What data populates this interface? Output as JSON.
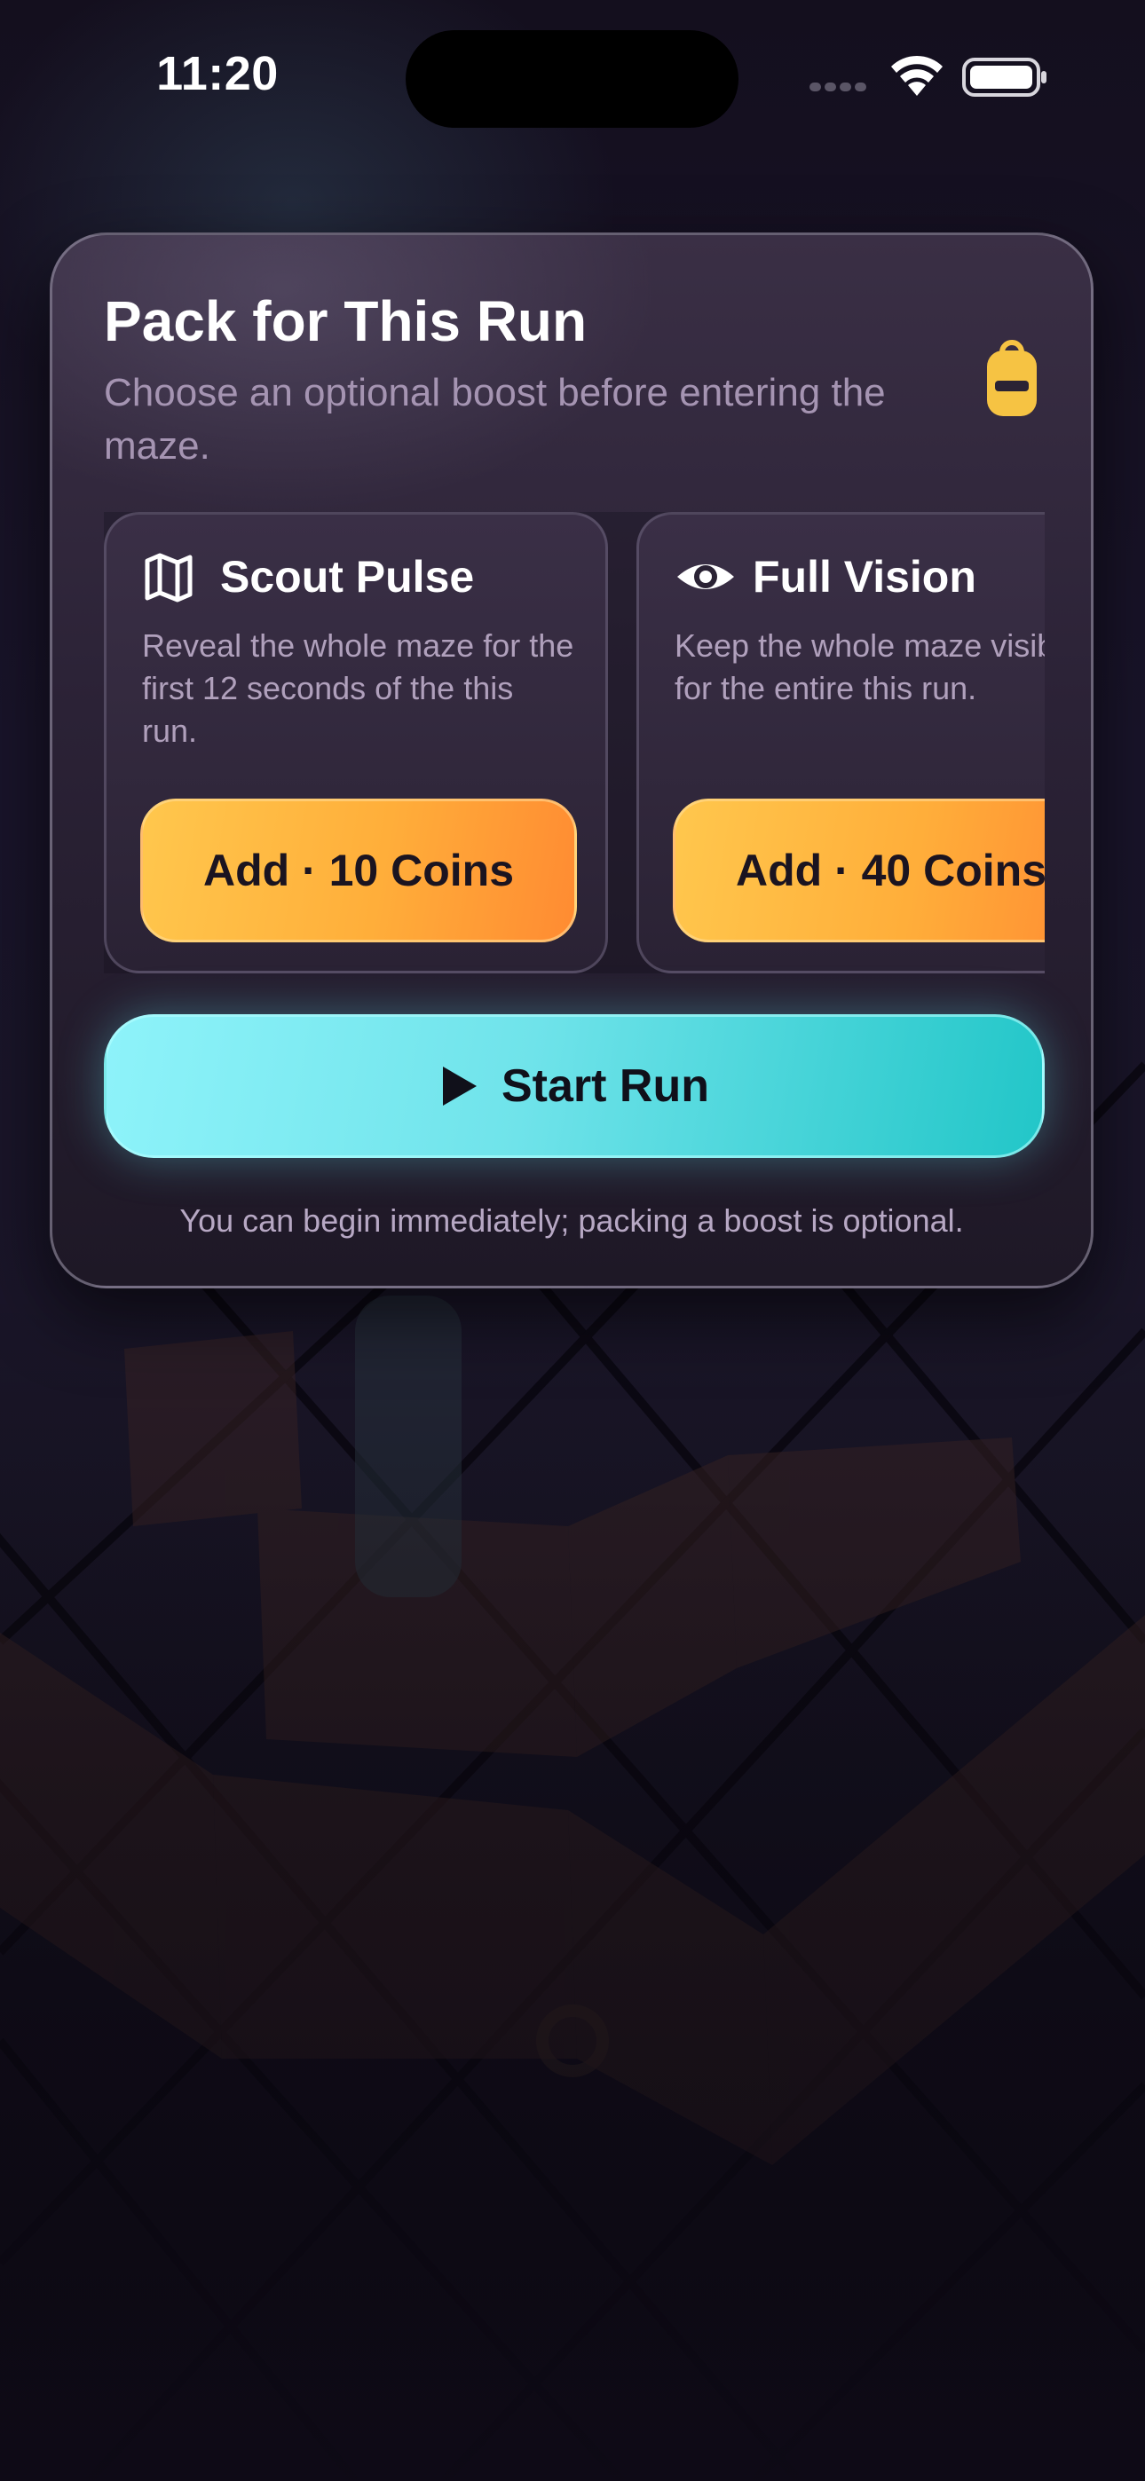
{
  "status_bar": {
    "time": "11:20"
  },
  "panel": {
    "title": "Pack for This Run",
    "subtitle": "Choose an optional boost before entering the maze.",
    "icon": "backpack-icon",
    "boosts": [
      {
        "icon": "map-icon",
        "title": "Scout Pulse",
        "description": "Reveal the whole maze for the first 12 seconds of the this run.",
        "button_label": "Add · 10 Coins"
      },
      {
        "icon": "eye-icon",
        "title": "Full Vision",
        "description": "Keep the whole maze visible for the entire this run.",
        "button_label": "Add · 40 Coins"
      }
    ],
    "start_button_label": "Start Run",
    "footnote": "You can begin immediately; packing a boost is optional."
  },
  "colors": {
    "accent_cyan": "#6fe3ea",
    "accent_orange": "#ffae3a",
    "icon_yellow": "#f6c343"
  }
}
